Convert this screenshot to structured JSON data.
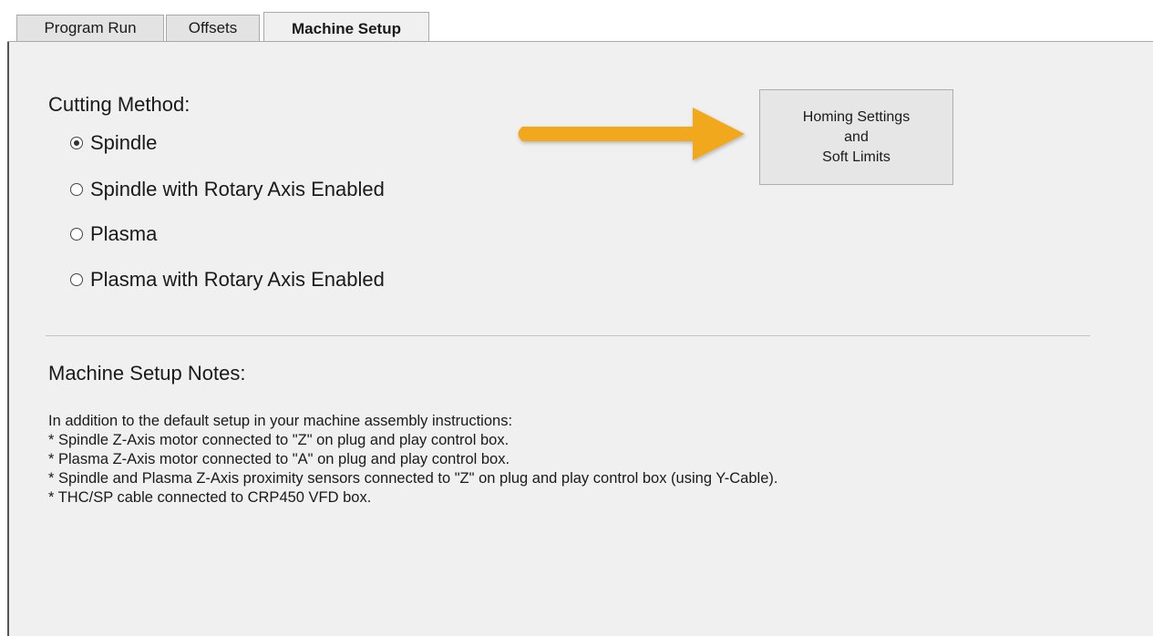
{
  "tabs": [
    {
      "label": "Program Run",
      "active": false
    },
    {
      "label": "Offsets",
      "active": false
    },
    {
      "label": "Machine Setup",
      "active": true
    }
  ],
  "cutting_method": {
    "title": "Cutting Method:",
    "options": [
      {
        "label": "Spindle",
        "selected": true
      },
      {
        "label": "Spindle with Rotary Axis Enabled",
        "selected": false
      },
      {
        "label": "Plasma",
        "selected": false
      },
      {
        "label": "Plasma with Rotary Axis Enabled",
        "selected": false
      }
    ]
  },
  "homing_button": {
    "line1": "Homing Settings",
    "line2": "and",
    "line3": "Soft Limits"
  },
  "annotation_arrow": {
    "color": "#f2a81c",
    "icon": "arrow-right-icon"
  },
  "notes": {
    "title": "Machine Setup Notes:",
    "lines": [
      "In addition to the default setup in your machine assembly instructions:",
      "* Spindle Z-Axis motor connected to \"Z\" on plug and play control box.",
      "* Plasma Z-Axis motor connected to \"A\" on plug and play control box.",
      "* Spindle and Plasma Z-Axis proximity sensors connected to \"Z\" on plug and play control box (using Y-Cable).",
      "* THC/SP cable connected to CRP450 VFD box."
    ]
  }
}
